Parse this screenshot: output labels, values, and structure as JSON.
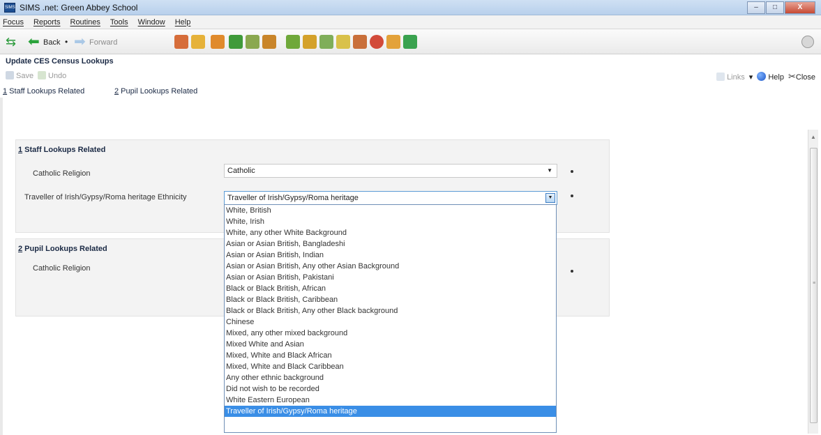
{
  "window": {
    "icon_text": "SIMS",
    "title": "SIMS .net: Green Abbey School",
    "controls": [
      "–",
      "□",
      "X"
    ]
  },
  "menu": [
    "Focus",
    "Reports",
    "Routines",
    "Tools",
    "Window",
    "Help"
  ],
  "toolbar": {
    "back_label": "Back",
    "forward_label": "Forward",
    "dot": "•",
    "icons": [
      "people-icon",
      "person-icon",
      "book-icon",
      "flag-icon",
      "chart-icon",
      "cabinet-icon",
      "binder-icon",
      "binder2-icon",
      "document-icon",
      "edit-icon",
      "user-icon",
      "clock-icon",
      "user2-icon",
      "arrows-icon",
      "settings-icon"
    ]
  },
  "page": {
    "title": "Update CES Census Lookups",
    "save_label": "Save",
    "undo_label": "Undo",
    "links_label": "Links",
    "links_caret": "▾",
    "help_label": "Help",
    "close_label": "Close"
  },
  "nav_links": [
    {
      "num": "1",
      "label": " Staff Lookups Related"
    },
    {
      "num": "2",
      "label": " Pupil Lookups Related"
    }
  ],
  "sections": {
    "staff": {
      "num": "1",
      "title": " Staff Lookups Related",
      "catholic_label": "Catholic Religion",
      "catholic_value": "Catholic",
      "traveller_label": "Traveller of Irish/Gypsy/Roma heritage Ethnicity",
      "traveller_value": "Traveller of Irish/Gypsy/Roma heritage"
    },
    "pupil": {
      "num": "2",
      "title": " Pupil Lookups Related",
      "catholic_label": "Catholic Religion"
    }
  },
  "dropdown_options": [
    "White, British",
    "White, Irish",
    "White, any other White Background",
    "Asian or Asian British, Bangladeshi",
    "Asian or Asian British, Indian",
    "Asian or Asian British, Any other Asian Background",
    "Asian or Asian British, Pakistani",
    "Black or Black British, African",
    "Black or Black British, Caribbean",
    "Black or Black British, Any other Black background",
    "Chinese",
    "Mixed, any other mixed background",
    "Mixed White and Asian",
    "Mixed, White and Black African",
    "Mixed, White and Black Caribbean",
    "Any other ethnic background",
    "Did not wish to be recorded",
    "White Eastern European",
    "Traveller of Irish/Gypsy/Roma heritage"
  ],
  "dropdown_selected_index": 18,
  "glyphs": {
    "arrow_down": "▼",
    "arrow_up": "▲",
    "grip": "≡",
    "scissors": "✂",
    "home": "⇆",
    "back": "⬅",
    "forward": "➡"
  }
}
